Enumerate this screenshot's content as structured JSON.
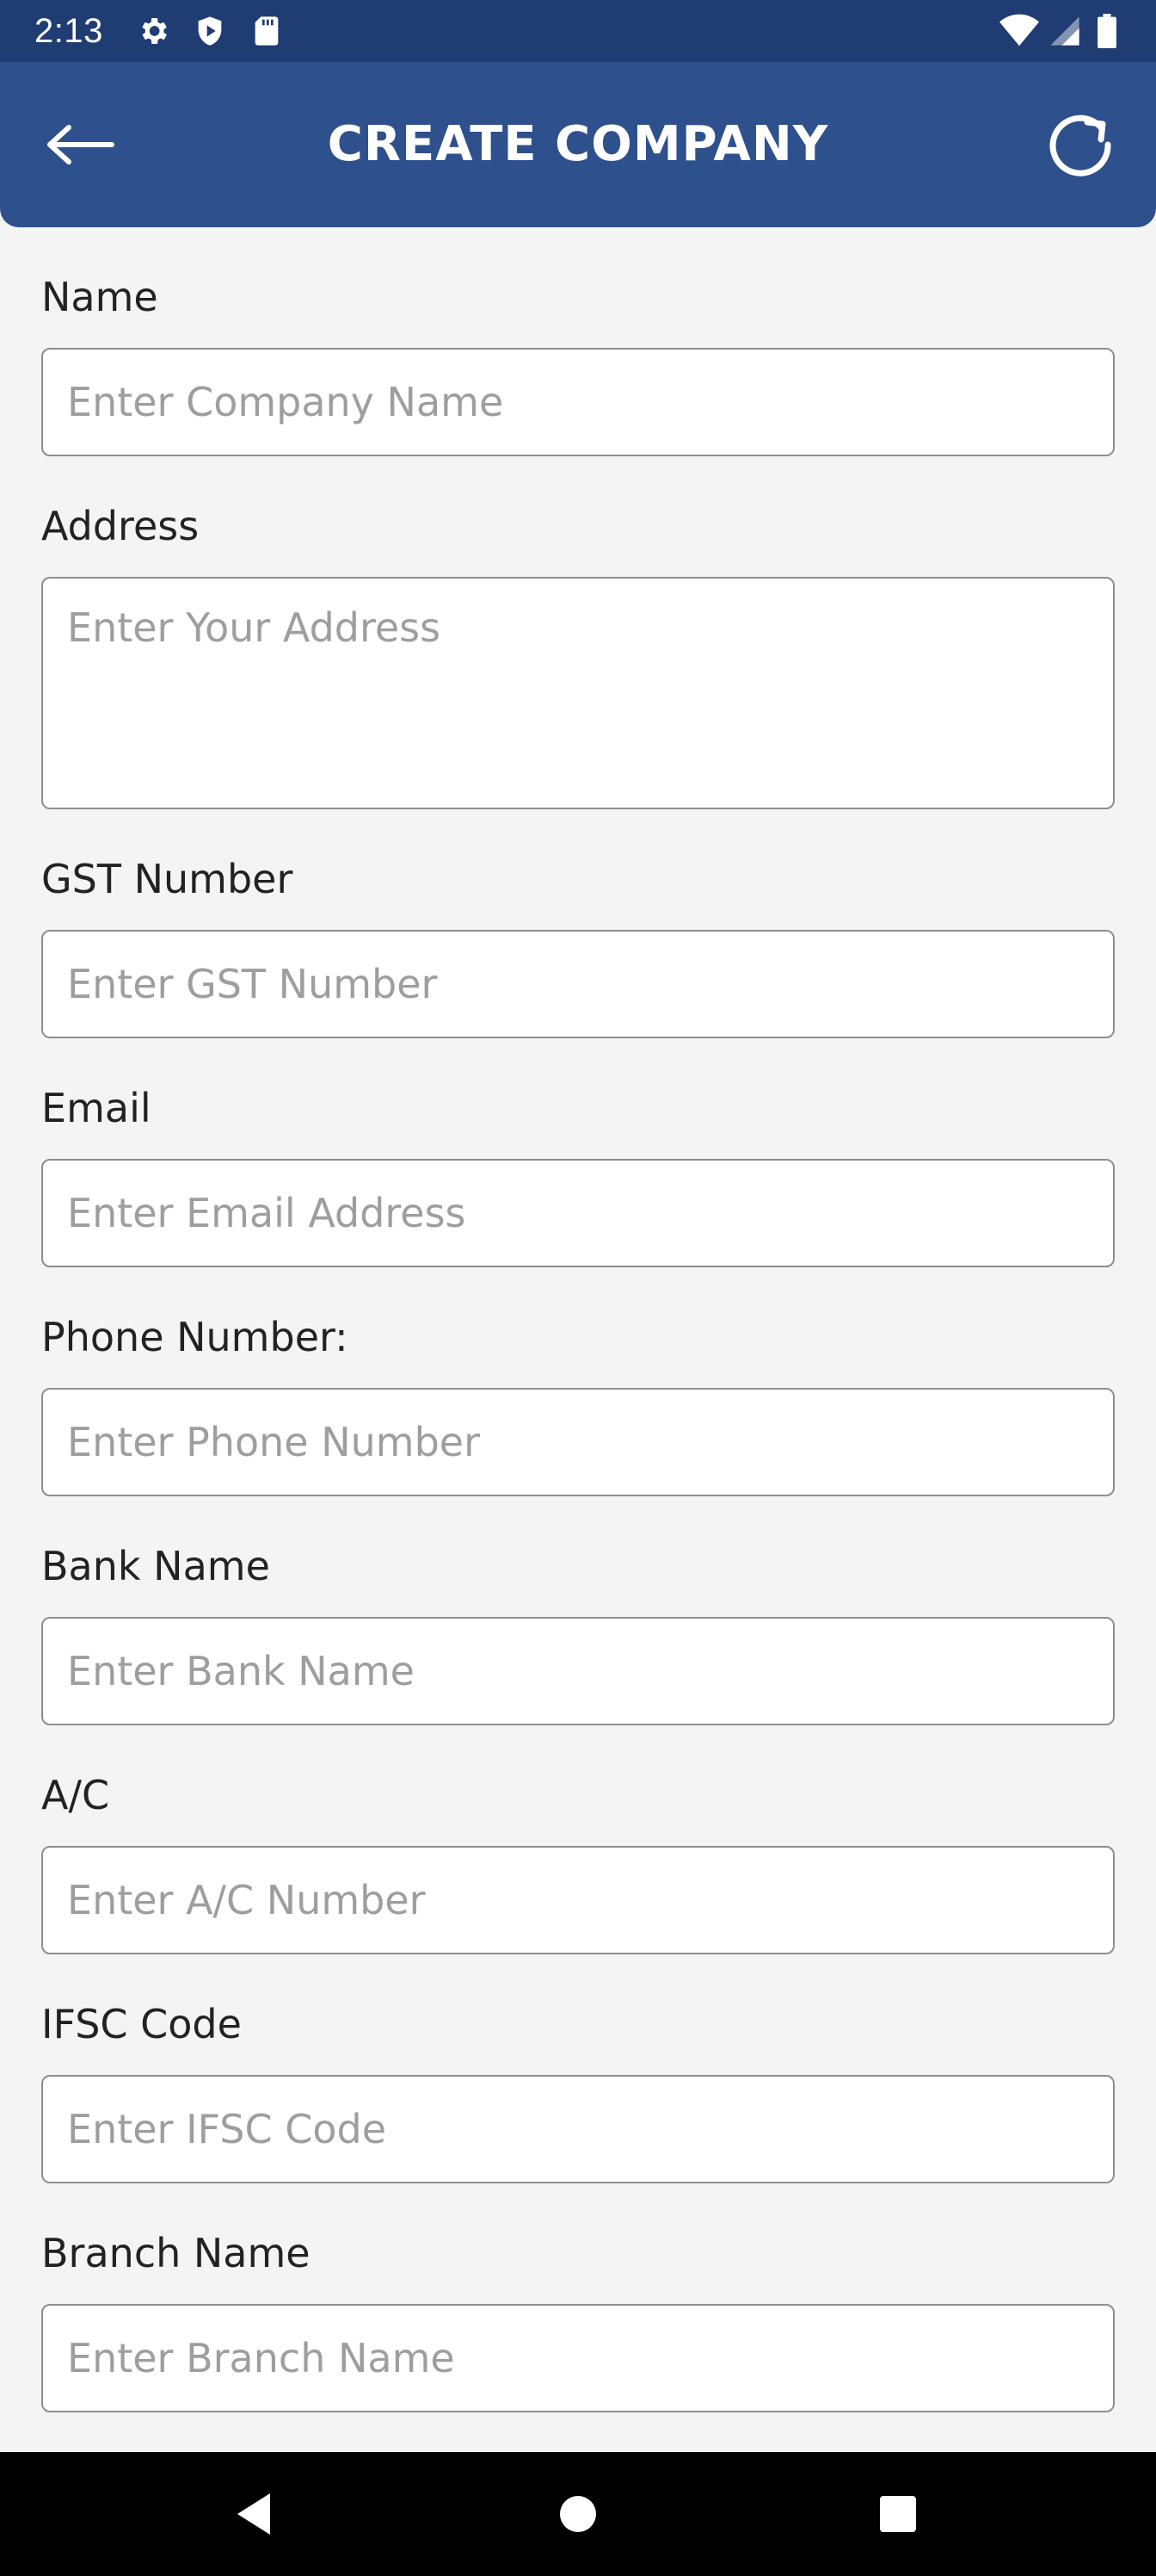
{
  "status_bar": {
    "time": "2:13",
    "icons": [
      "gear-icon",
      "shield-icon",
      "sd-card-icon",
      "wifi-icon",
      "signal-icon",
      "battery-icon"
    ]
  },
  "app_bar": {
    "title": "CREATE COMPANY",
    "back_icon": "arrow-left-icon",
    "refresh_icon": "refresh-icon",
    "background_color": "#2e508c"
  },
  "form": {
    "fields": [
      {
        "label": "Name",
        "placeholder": "Enter Company Name",
        "value": ""
      },
      {
        "label": "Address",
        "placeholder": "Enter Your Address",
        "value": ""
      },
      {
        "label": "GST Number",
        "placeholder": "Enter GST Number",
        "value": ""
      },
      {
        "label": "Email",
        "placeholder": "Enter Email Address",
        "value": ""
      },
      {
        "label": "Phone Number:",
        "placeholder": "Enter Phone Number",
        "value": ""
      },
      {
        "label": "Bank Name",
        "placeholder": "Enter Bank Name",
        "value": ""
      },
      {
        "label": "A/C",
        "placeholder": "Enter A/C Number",
        "value": ""
      },
      {
        "label": "IFSC Code",
        "placeholder": "Enter IFSC Code",
        "value": ""
      },
      {
        "label": "Branch Name",
        "placeholder": "Enter Branch Name",
        "value": ""
      }
    ]
  },
  "nav_bar": {
    "icons": [
      "back-triangle-icon",
      "home-circle-icon",
      "recents-square-icon"
    ]
  }
}
